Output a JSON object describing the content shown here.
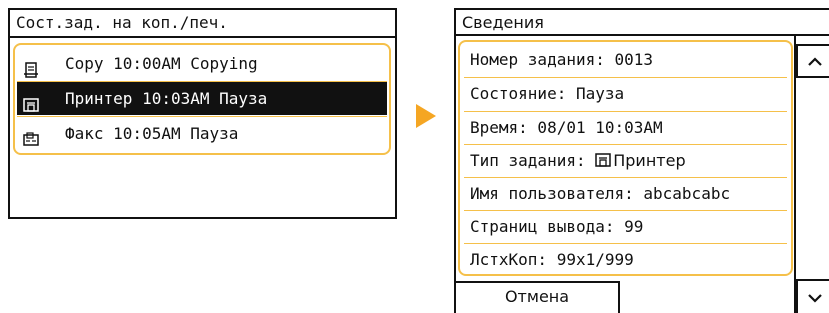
{
  "left_panel": {
    "title": "Сост.зад. на коп./печ.",
    "jobs": [
      {
        "icon": "copy-icon",
        "text": "Copy 10:00AM Copying",
        "selected": false
      },
      {
        "icon": "printer-icon",
        "text": "Принтер 10:03AM Пауза",
        "selected": true
      },
      {
        "icon": "fax-icon",
        "text": "Факс 10:05AM Пауза",
        "selected": false
      }
    ]
  },
  "arrow": {
    "icon": "arrow-right-icon",
    "color": "#f5a623"
  },
  "right_panel": {
    "title": "Сведения",
    "details": [
      {
        "text": "Номер задания: 0013"
      },
      {
        "text": "Состояние: Пауза"
      },
      {
        "text": "Время: 08/01 10:03AM"
      },
      {
        "label": "Тип задания: ",
        "icon": "printer-icon",
        "value": "Принтер"
      },
      {
        "text": "Имя пользователя: abcabcabc"
      },
      {
        "text": "Страниц вывода: 99"
      },
      {
        "text": "ЛстхКоп: 99x1/999"
      }
    ],
    "cancel_label": "Отмена",
    "scroll_up_icon": "chevron-up-icon",
    "scroll_down_icon": "chevron-down-icon"
  },
  "colors": {
    "highlight_frame": "#f5c04a",
    "selection_bg": "#111111",
    "arrow": "#f5a623"
  }
}
